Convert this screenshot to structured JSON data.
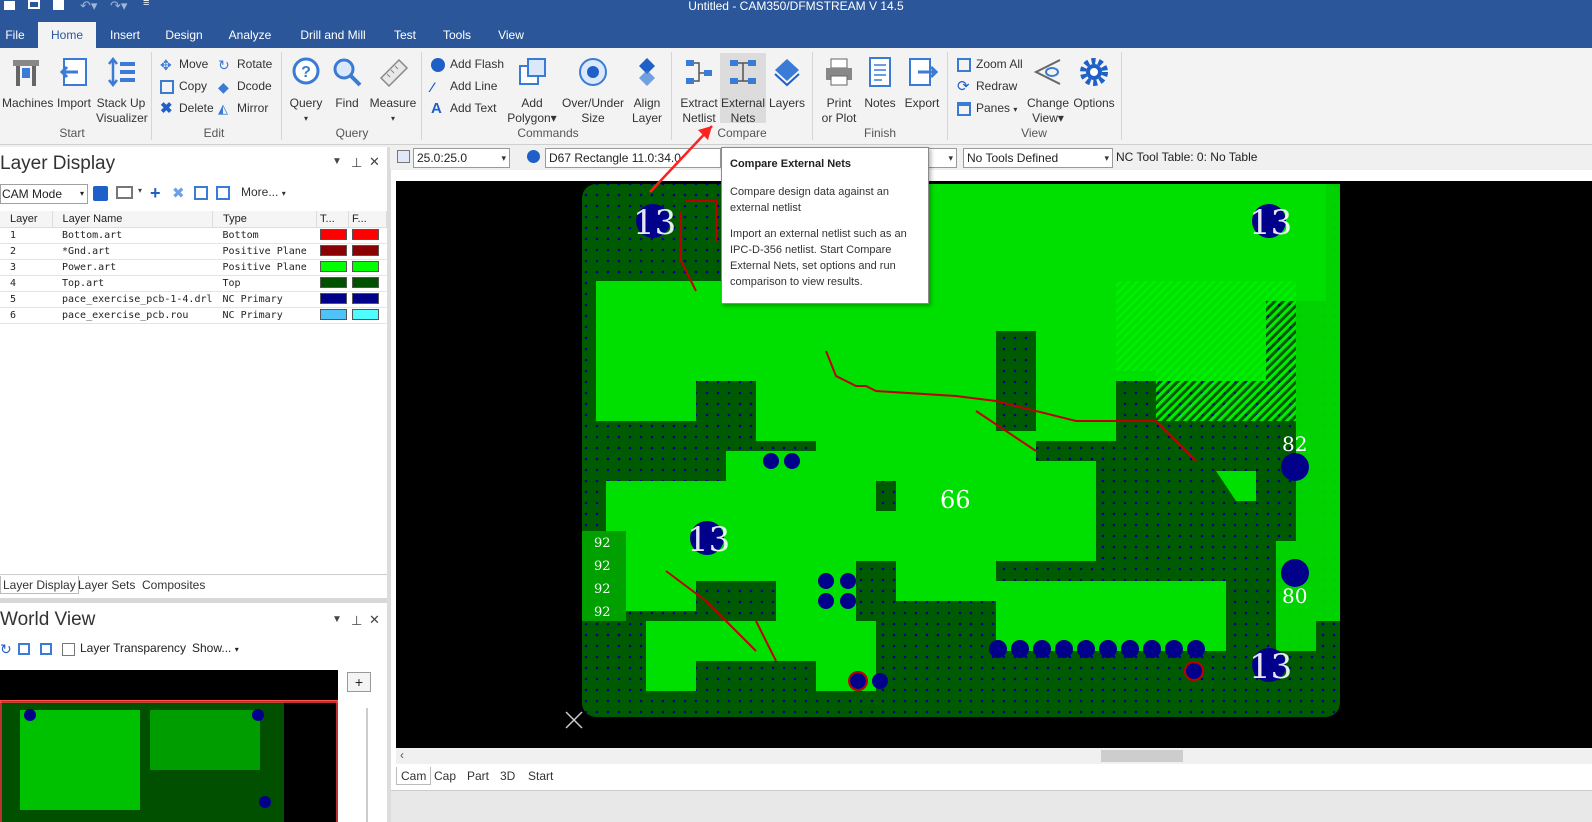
{
  "app": {
    "title": "Untitled - CAM350/DFMSTREAM V 14.5"
  },
  "menu": {
    "tabs": [
      "File",
      "Home",
      "Insert",
      "Design",
      "Analyze",
      "Drill and Mill",
      "Test",
      "Tools",
      "View"
    ]
  },
  "ribbon": {
    "start": {
      "machines": "Machines",
      "import": "Import",
      "stackup_1": "Stack Up",
      "stackup_2": "Visualizer",
      "group": "Start"
    },
    "edit": {
      "move": "Move",
      "copy": "Copy",
      "delete": "Delete",
      "rotate": "Rotate",
      "dcode": "Dcode",
      "mirror": "Mirror",
      "group": "Edit"
    },
    "query": {
      "query": "Query",
      "find": "Find",
      "measure": "Measure",
      "group": "Query"
    },
    "commands": {
      "add_flash": "Add Flash",
      "add_line": "Add Line",
      "add_text": "Add Text",
      "add_polygon_1": "Add",
      "add_polygon_2": "Polygon",
      "overunder_1": "Over/Under",
      "overunder_2": "Size",
      "align_1": "Align",
      "align_2": "Layer",
      "group": "Commands"
    },
    "compare": {
      "extract_1": "Extract",
      "extract_2": "Netlist",
      "external_1": "External",
      "external_2": "Nets",
      "layers": "Layers",
      "group": "Compare"
    },
    "finish": {
      "print_1": "Print",
      "print_2": "or Plot",
      "notes": "Notes",
      "export": "Export",
      "group": "Finish"
    },
    "view": {
      "zoom_all": "Zoom All",
      "redraw": "Redraw",
      "panes": "Panes",
      "change_1": "Change",
      "change_2": "View",
      "options": "Options",
      "group": "View"
    }
  },
  "layer_display": {
    "title": "Layer Display",
    "mode": "CAM Mode",
    "more": "More...",
    "columns": [
      "Layer",
      "Layer Name",
      "Type",
      "T...",
      "F..."
    ],
    "rows": [
      {
        "num": "1",
        "name": "Bottom.art",
        "type": "Bottom",
        "c1": "#ff0000",
        "c2": "#ff0000"
      },
      {
        "num": "2",
        "name": "*Gnd.art",
        "type": "Positive Plane",
        "c1": "#8b0000",
        "c2": "#8b0000"
      },
      {
        "num": "3",
        "name": "Power.art",
        "type": "Positive Plane",
        "c1": "#00ff00",
        "c2": "#00ff00"
      },
      {
        "num": "4",
        "name": "Top.art",
        "type": "Top",
        "c1": "#005000",
        "c2": "#005000"
      },
      {
        "num": "5",
        "name": "pace_exercise_pcb-1-4.drl",
        "type": "NC Primary",
        "c1": "#00008b",
        "c2": "#00008b"
      },
      {
        "num": "6",
        "name": "pace_exercise_pcb.rou",
        "type": "NC Primary",
        "c1": "#4fc3f7",
        "c2": "#4ffcff"
      }
    ],
    "tabs": [
      "Layer Display",
      "Layer Sets",
      "Composites"
    ]
  },
  "world_view": {
    "title": "World View",
    "transparency": "Layer Transparency",
    "show": "Show..."
  },
  "toolbar": {
    "grid": "25.0:25.0",
    "dcode": "D67  Rectangle 11.0:34.0",
    "tools": "No Tools Defined",
    "nc_table": "NC Tool Table: 0: No Table"
  },
  "tooltip": {
    "title": "Compare External Nets",
    "p1": "Compare design data against an external netlist",
    "p2": "Import an external netlist such as an IPC-D-356 netlist. Start Compare External Nets, set options and run comparison to view results."
  },
  "board_labels": {
    "a": "13",
    "b": "13",
    "c": "13",
    "d": "13",
    "e": "82",
    "f": "80",
    "g": "66",
    "h": "92"
  },
  "canvas_tabs": [
    "Cam",
    "Cap",
    "Part",
    "3D",
    "Start"
  ],
  "colors": {
    "title_bar": "#2b579a",
    "pcb_green": "#00e000",
    "pcb_dark": "#006400",
    "drill": "#00008b"
  }
}
